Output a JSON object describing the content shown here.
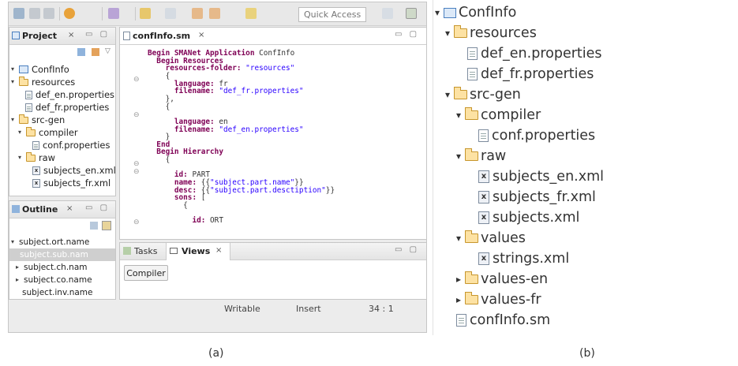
{
  "toolbar": {
    "quick_access_placeholder": "Quick Access"
  },
  "project_view": {
    "tab_label": "Project",
    "items": [
      {
        "label": "ConfInfo",
        "type": "project"
      },
      {
        "label": "resources",
        "type": "folder"
      },
      {
        "label": "def_en.properties",
        "type": "file"
      },
      {
        "label": "def_fr.properties",
        "type": "file"
      },
      {
        "label": "src-gen",
        "type": "folder"
      },
      {
        "label": "compiler",
        "type": "folder"
      },
      {
        "label": "conf.properties",
        "type": "file"
      },
      {
        "label": "raw",
        "type": "folder"
      },
      {
        "label": "subjects_en.xml",
        "type": "xml"
      },
      {
        "label": "subjects_fr.xml",
        "type": "xml"
      }
    ]
  },
  "outline_view": {
    "tab_label": "Outline",
    "items": [
      "subject.ort.name",
      "subject.sub.nam",
      "subject.ch.nam",
      "subject.co.name",
      "subject.inv.name"
    ]
  },
  "editor": {
    "tab_label": "confInfo.sm",
    "lines": [
      [
        [
          "kw",
          "Begin SMANet Application"
        ],
        [
          "t",
          " ConfInfo"
        ]
      ],
      [
        [
          "t",
          "  "
        ],
        [
          "kw",
          "Begin Resources"
        ]
      ],
      [
        [
          "t",
          "    "
        ],
        [
          "kw",
          "resources-folder:"
        ],
        [
          "str",
          " \"resources\""
        ]
      ],
      [
        [
          "t",
          "    {"
        ]
      ],
      [
        [
          "t",
          "      "
        ],
        [
          "kw",
          "language:"
        ],
        [
          "t",
          " fr"
        ]
      ],
      [
        [
          "t",
          "      "
        ],
        [
          "kw",
          "filename:"
        ],
        [
          "str",
          " \"def_fr.properties\""
        ]
      ],
      [
        [
          "t",
          "    },"
        ]
      ],
      [
        [
          "t",
          "    {"
        ]
      ],
      [
        [
          "t",
          ""
        ]
      ],
      [
        [
          "t",
          "      "
        ],
        [
          "kw",
          "language:"
        ],
        [
          "t",
          " en"
        ]
      ],
      [
        [
          "t",
          "      "
        ],
        [
          "kw",
          "filename:"
        ],
        [
          "str",
          " \"def_en.properties\""
        ]
      ],
      [
        [
          "t",
          "    }"
        ]
      ],
      [
        [
          "t",
          "  "
        ],
        [
          "kw",
          "End"
        ]
      ],
      [
        [
          "t",
          "  "
        ],
        [
          "kw",
          "Begin Hierarchy"
        ]
      ],
      [
        [
          "t",
          "    {"
        ]
      ],
      [
        [
          "t",
          ""
        ]
      ],
      [
        [
          "t",
          "      "
        ],
        [
          "kw",
          "id:"
        ],
        [
          "t",
          " PART"
        ]
      ],
      [
        [
          "t",
          "      "
        ],
        [
          "kw",
          "name:"
        ],
        [
          "t",
          " {{"
        ],
        [
          "str",
          "\"subject.part.name\""
        ],
        [
          "t",
          "}}"
        ]
      ],
      [
        [
          "t",
          "      "
        ],
        [
          "kw",
          "desc:"
        ],
        [
          "t",
          " {{"
        ],
        [
          "str",
          "\"subject.part.desctiption\""
        ],
        [
          "t",
          "}}"
        ]
      ],
      [
        [
          "t",
          "      "
        ],
        [
          "kw",
          "sons:"
        ],
        [
          "t",
          " ["
        ]
      ],
      [
        [
          "t",
          "        {"
        ]
      ],
      [
        [
          "t",
          ""
        ]
      ],
      [
        [
          "t",
          "          "
        ],
        [
          "kw",
          "id:"
        ],
        [
          "t",
          " ORT"
        ]
      ]
    ]
  },
  "bottom_view": {
    "tab_tasks": "Tasks",
    "tab_views": "Views",
    "compiler_button": "Compiler"
  },
  "status_bar": {
    "mode": "Writable",
    "insert": "Insert",
    "position": "34 : 1"
  },
  "big_tree": {
    "items": [
      {
        "label": "ConfInfo",
        "type": "project"
      },
      {
        "label": "resources",
        "type": "folder"
      },
      {
        "label": "def_en.properties",
        "type": "file"
      },
      {
        "label": "def_fr.properties",
        "type": "file"
      },
      {
        "label": "src-gen",
        "type": "folder"
      },
      {
        "label": "compiler",
        "type": "folder"
      },
      {
        "label": "conf.properties",
        "type": "file"
      },
      {
        "label": "raw",
        "type": "folder"
      },
      {
        "label": "subjects_en.xml",
        "type": "xml"
      },
      {
        "label": "subjects_fr.xml",
        "type": "xml"
      },
      {
        "label": "subjects.xml",
        "type": "xml"
      },
      {
        "label": "values",
        "type": "folder"
      },
      {
        "label": "strings.xml",
        "type": "xml"
      },
      {
        "label": "values-en",
        "type": "folder"
      },
      {
        "label": "values-fr",
        "type": "folder"
      },
      {
        "label": "confInfo.sm",
        "type": "file"
      }
    ]
  },
  "captions": {
    "a": "(a)",
    "b": "(b)"
  }
}
